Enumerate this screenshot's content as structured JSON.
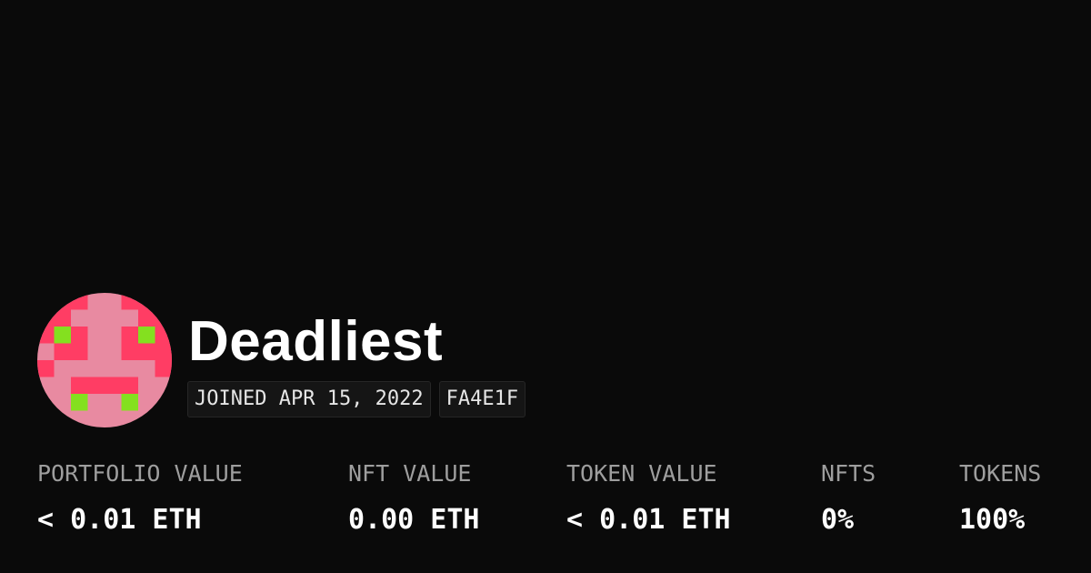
{
  "profile": {
    "name": "Deadliest",
    "joined": "JOINED APR 15, 2022",
    "address_color_code": "FA4E1F",
    "avatar": {
      "icon": "pixel-face-avatar-icon",
      "colors": {
        "background": "#e88aa1",
        "primary": "#ff3d64",
        "accent": "#84e01f"
      }
    }
  },
  "stats": [
    {
      "label": "PORTFOLIO VALUE",
      "value": "< 0.01 ETH"
    },
    {
      "label": "NFT VALUE",
      "value": "0.00 ETH"
    },
    {
      "label": "TOKEN VALUE",
      "value": "< 0.01 ETH"
    },
    {
      "label": "NFTS",
      "value": "0%"
    },
    {
      "label": "TOKENS",
      "value": "100%"
    }
  ],
  "theme": {
    "background": "#0a0a0a",
    "text": "#ffffff",
    "muted": "#9e9e9e"
  }
}
